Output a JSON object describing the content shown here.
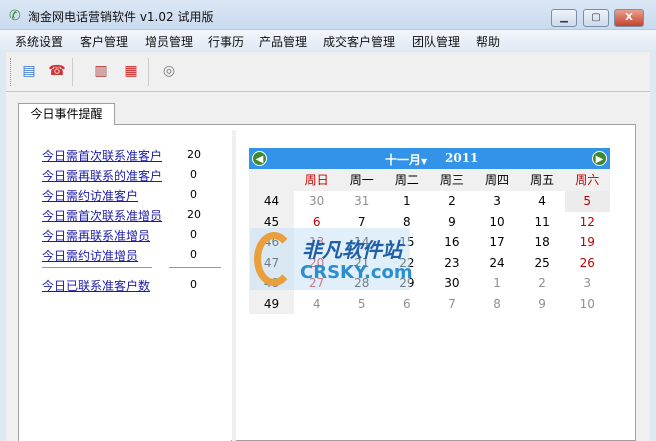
{
  "window": {
    "title": "淘金网电话营销软件 v1.02 试用版",
    "minimize": "▭",
    "maximize": "▢",
    "close": "X"
  },
  "menu": [
    "系统设置",
    "客户管理",
    "增员管理",
    "行事历",
    "产品管理",
    "成交客户管理",
    "团队管理",
    "帮助"
  ],
  "toolbar": [
    "customer-card-icon",
    "call-contact-icon",
    "reports-icon",
    "calendar-icon",
    "camera-icon"
  ],
  "tab": "今日事件提醒",
  "reminders": [
    {
      "label": "今日需首次联系准客户",
      "value": "20"
    },
    {
      "label": "今日需再联系的准客户",
      "value": "0"
    },
    {
      "label": "今日需约访准客户",
      "value": "0"
    },
    {
      "label": "今日需首次联系准增员",
      "value": "20"
    },
    {
      "label": "今日需再联系准增员",
      "value": "0"
    },
    {
      "label": "今日需约访准增员",
      "value": "0"
    }
  ],
  "total": {
    "label": "今日已联系准客户数",
    "value": "0"
  },
  "calendar": {
    "month": "十一月",
    "year": "2011",
    "weekdays": [
      "周日",
      "周一",
      "周二",
      "周三",
      "周四",
      "周五",
      "周六"
    ],
    "weeks": [
      {
        "wk": "44",
        "days": [
          "30",
          "31",
          "1",
          "2",
          "3",
          "4",
          "5"
        ]
      },
      {
        "wk": "45",
        "days": [
          "6",
          "7",
          "8",
          "9",
          "10",
          "11",
          "12"
        ]
      },
      {
        "wk": "46",
        "days": [
          "13",
          "14",
          "15",
          "16",
          "17",
          "18",
          "19"
        ]
      },
      {
        "wk": "47",
        "days": [
          "20",
          "21",
          "22",
          "23",
          "24",
          "25",
          "26"
        ]
      },
      {
        "wk": "48",
        "days": [
          "27",
          "28",
          "29",
          "30",
          "1",
          "2",
          "3"
        ]
      },
      {
        "wk": "49",
        "days": [
          "4",
          "5",
          "6",
          "7",
          "8",
          "9",
          "10"
        ]
      }
    ],
    "today": "5"
  },
  "watermark": {
    "line1": "非凡软件站",
    "line2": "CRSKY.com"
  }
}
